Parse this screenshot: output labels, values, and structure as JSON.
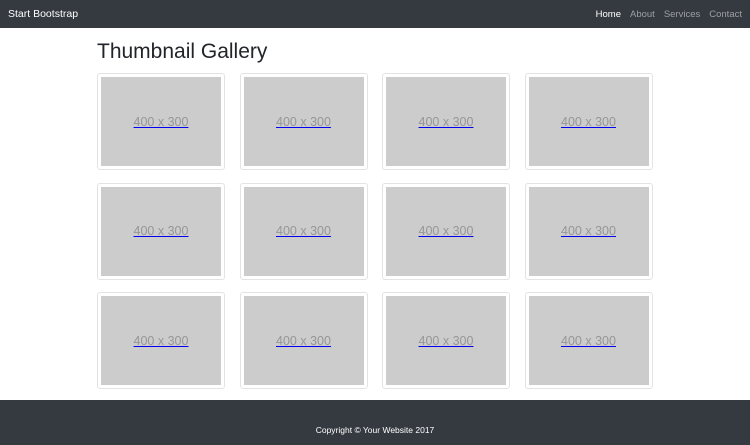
{
  "navbar": {
    "brand": "Start Bootstrap",
    "links": [
      "Home",
      "About",
      "Services",
      "Contact"
    ],
    "active": "Home"
  },
  "page": {
    "title": "Thumbnail Gallery"
  },
  "gallery": {
    "items": [
      {
        "label": "400 x 300"
      },
      {
        "label": "400 x 300"
      },
      {
        "label": "400 x 300"
      },
      {
        "label": "400 x 300"
      },
      {
        "label": "400 x 300"
      },
      {
        "label": "400 x 300"
      },
      {
        "label": "400 x 300"
      },
      {
        "label": "400 x 300"
      },
      {
        "label": "400 x 300"
      },
      {
        "label": "400 x 300"
      },
      {
        "label": "400 x 300"
      },
      {
        "label": "400 x 300"
      }
    ]
  },
  "footer": {
    "copyright": "Copyright © Your Website 2017"
  },
  "colors": {
    "nav_bg": "#343a40",
    "placeholder": "#cccccc",
    "placeholder_text": "#969696"
  }
}
